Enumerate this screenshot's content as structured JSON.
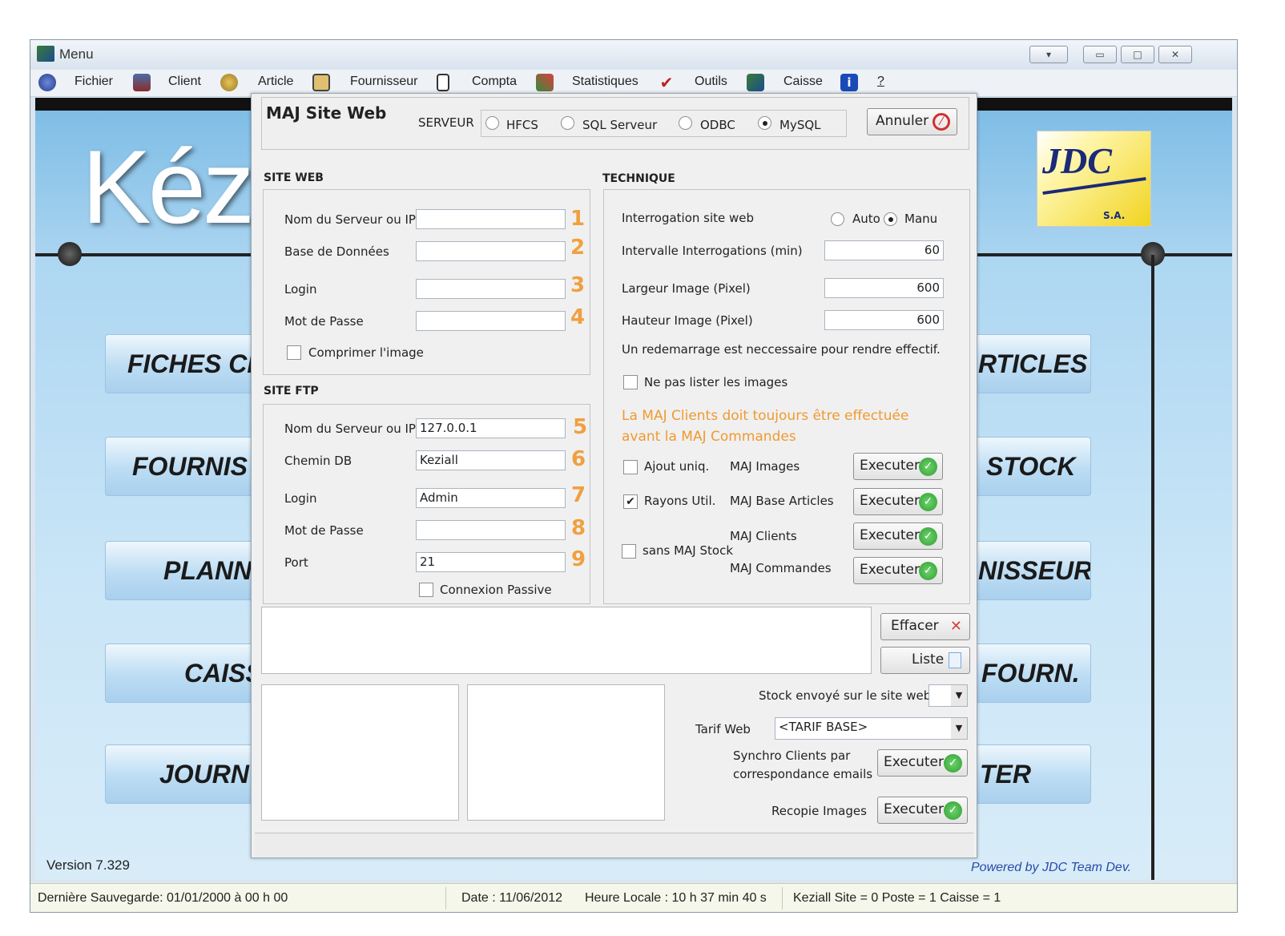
{
  "window": {
    "title": "Menu"
  },
  "menu": [
    {
      "label": "Fichier"
    },
    {
      "label": "Client"
    },
    {
      "label": "Article"
    },
    {
      "label": "Fournisseur"
    },
    {
      "label": "Compta"
    },
    {
      "label": "Statistiques"
    },
    {
      "label": "Outils"
    },
    {
      "label": "Caisse"
    },
    {
      "label": "?"
    }
  ],
  "background": {
    "logo_text": "Kéz",
    "buttons_left": [
      "FICHES CL",
      "FOURNIS",
      "PLANNI",
      "CAISS",
      "JOURN"
    ],
    "buttons_right": [
      "RTICLES",
      "STOCK",
      "NISSEUR",
      "FOURN.",
      "TER"
    ],
    "jdc_logo": "JDC",
    "jdc_sub": "S.A.",
    "version": "Version 7.329",
    "powered": "Powered by JDC Team Dev."
  },
  "statusbar": {
    "backup": "Dernière Sauvegarde: 01/01/2000 à 00 h 00",
    "date": "Date : 11/06/2012",
    "time": "Heure Locale : 10 h 37 min 40 s",
    "site": "Keziall  Site = 0  Poste = 1  Caisse = 1"
  },
  "dialog": {
    "title": "MAJ Site Web",
    "server_label": "SERVEUR",
    "server_options": [
      "HFCS",
      "SQL Serveur",
      "ODBC",
      "MySQL"
    ],
    "server_selected": "MySQL",
    "cancel": "Annuler",
    "siteweb": {
      "heading": "SITE WEB",
      "fields": [
        {
          "label": "Nom du Serveur ou IP",
          "value": "",
          "num": "1"
        },
        {
          "label": "Base de Données",
          "value": "",
          "num": "2"
        },
        {
          "label": "Login",
          "value": "",
          "num": "3"
        },
        {
          "label": "Mot de Passe",
          "value": "",
          "num": "4"
        }
      ],
      "compress": "Comprimer l'image"
    },
    "siteftp": {
      "heading": "SITE FTP",
      "fields": [
        {
          "label": "Nom du Serveur ou IP",
          "value": "127.0.0.1",
          "num": "5"
        },
        {
          "label": "Chemin DB",
          "value": "Keziall",
          "num": "6"
        },
        {
          "label": "Login",
          "value": "Admin",
          "num": "7"
        },
        {
          "label": "Mot de Passe",
          "value": "",
          "num": "8"
        },
        {
          "label": "Port",
          "value": "21",
          "num": "9"
        }
      ],
      "passive": "Connexion Passive"
    },
    "technique": {
      "heading": "TECHNIQUE",
      "interrogation": "Interrogation site web",
      "auto": "Auto",
      "manu": "Manu",
      "intervalle_label": "Intervalle Interrogations (min)",
      "intervalle": "60",
      "largeur_label": "Largeur Image (Pixel)",
      "largeur": "600",
      "hauteur_label": "Hauteur Image (Pixel)",
      "hauteur": "600",
      "restart_note": "Un redemarrage est neccessaire pour rendre effectif.",
      "no_list_images": "Ne pas lister les images",
      "warning": "La MAJ Clients doit toujours être effectuée avant la MAJ Commandes",
      "ajout": "Ajout uniq.",
      "rayons": "Rayons Util.",
      "sans_stock": "sans MAJ Stock",
      "maj_images": "MAJ Images",
      "maj_base": "MAJ Base Articles",
      "maj_clients": "MAJ Clients",
      "maj_commandes": "MAJ Commandes",
      "execute": "Executer"
    },
    "effacer": "Effacer",
    "liste": "Liste",
    "stock_label": "Stock envoyé sur le site web",
    "tarif_label": "Tarif Web",
    "tarif_value": "<TARIF BASE>",
    "synchro_label1": "Synchro Clients par",
    "synchro_label2": "correspondance emails",
    "recopie_label": "Recopie Images",
    "execute": "Executer"
  }
}
